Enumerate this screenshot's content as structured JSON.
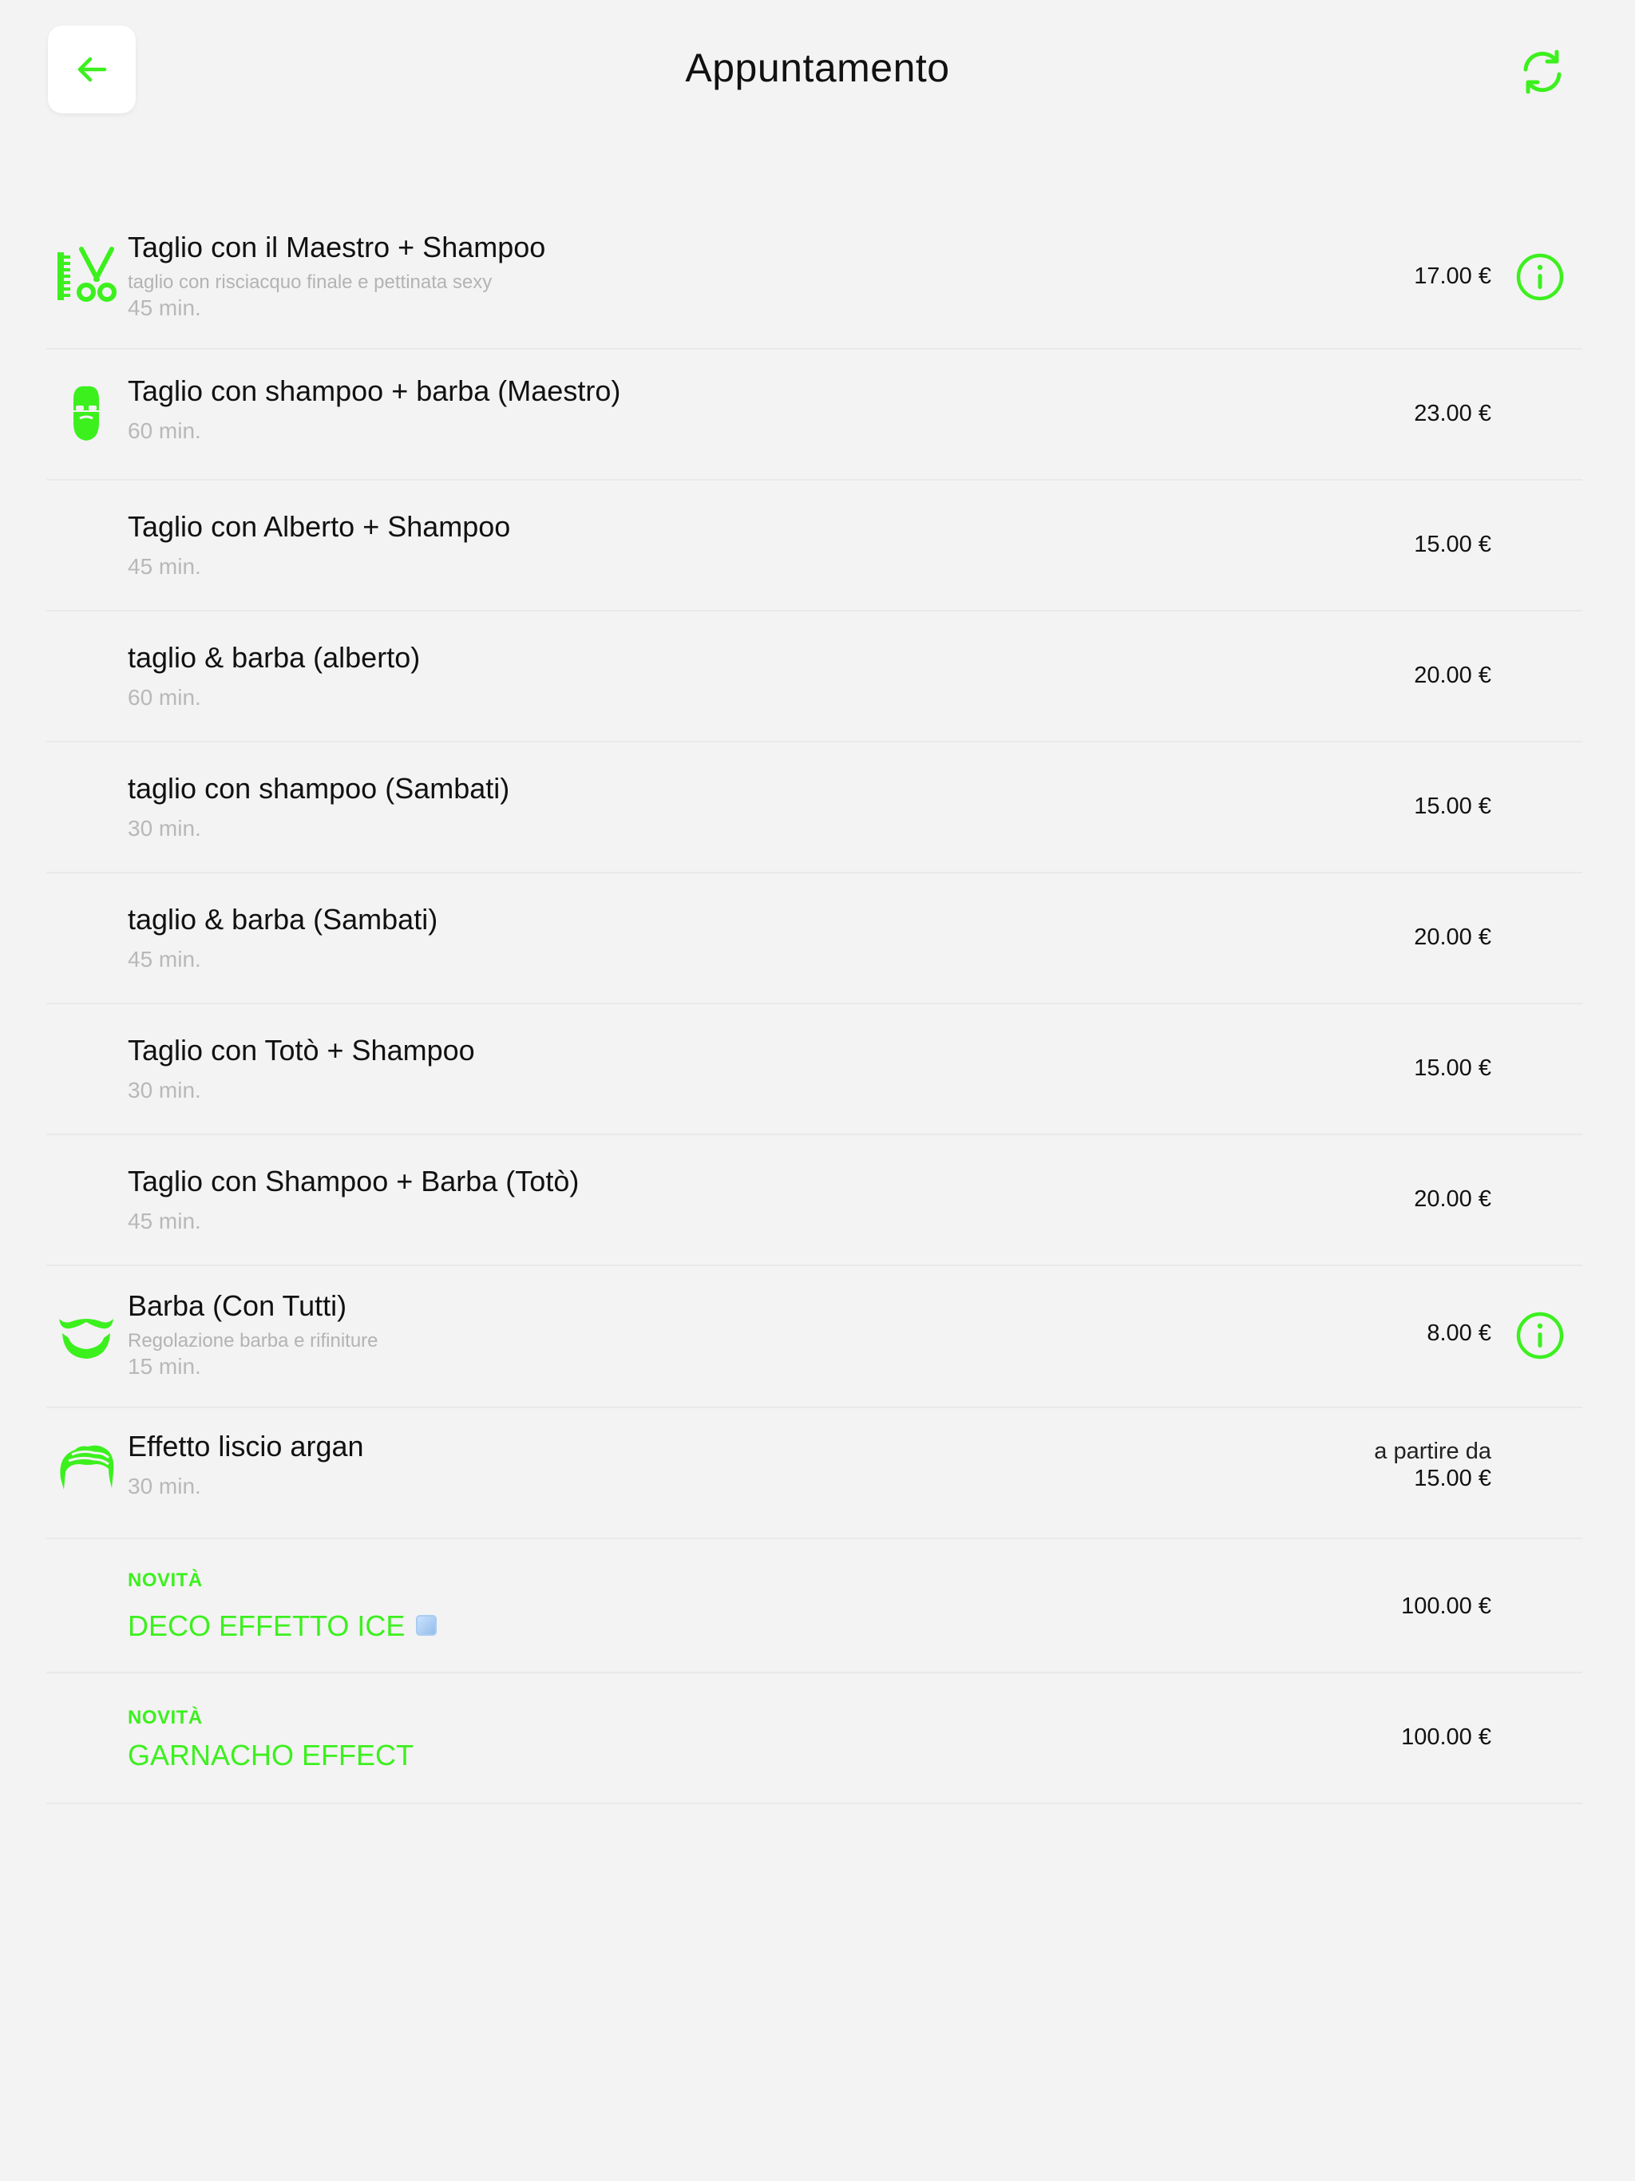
{
  "header": {
    "title": "Appuntamento"
  },
  "colors": {
    "accent": "#3cf01e",
    "background": "#f3f3f3",
    "text": "#111111",
    "muted": "#b8b8b8"
  },
  "services": [
    {
      "name": "Taglio con il Maestro + Shampoo",
      "description": "taglio con risciacquo finale e pettinata sexy",
      "duration": "45 min.",
      "price": "17.00 €",
      "icon": "comb-scissors-icon",
      "has_info": true
    },
    {
      "name": "Taglio con shampoo + barba (Maestro)",
      "duration": "60 min.",
      "price": "23.00 €",
      "icon": "bearded-man-icon",
      "has_info": false
    },
    {
      "name": "Taglio con Alberto + Shampoo",
      "duration": "45 min.",
      "price": "15.00 €"
    },
    {
      "name": "taglio & barba (alberto)",
      "duration": "60 min.",
      "price": "20.00 €"
    },
    {
      "name": "taglio con shampoo (Sambati)",
      "duration": "30 min.",
      "price": "15.00 €"
    },
    {
      "name": "taglio & barba (Sambati)",
      "duration": "45 min.",
      "price": "20.00 €"
    },
    {
      "name": "Taglio con Totò + Shampoo",
      "duration": "30 min.",
      "price": "15.00 €"
    },
    {
      "name": "Taglio con Shampoo + Barba (Totò)",
      "duration": "45 min.",
      "price": "20.00 €"
    },
    {
      "name": "Barba (Con Tutti)",
      "description": "Regolazione barba e rifiniture",
      "duration": "15 min.",
      "price": "8.00 €",
      "icon": "mustache-beard-icon",
      "has_info": true
    },
    {
      "name": "Effetto liscio argan",
      "duration": "30 min.",
      "price_prefix": "a partire da",
      "price": "15.00 €",
      "icon": "hair-icon"
    },
    {
      "badge": "NOVITÀ",
      "name": "DECO EFFETTO ICE",
      "price": "100.00 €",
      "emoji": "ice-cube-icon"
    },
    {
      "badge": "NOVITÀ",
      "name": "GARNACHO EFFECT",
      "price": "100.00 €"
    }
  ]
}
